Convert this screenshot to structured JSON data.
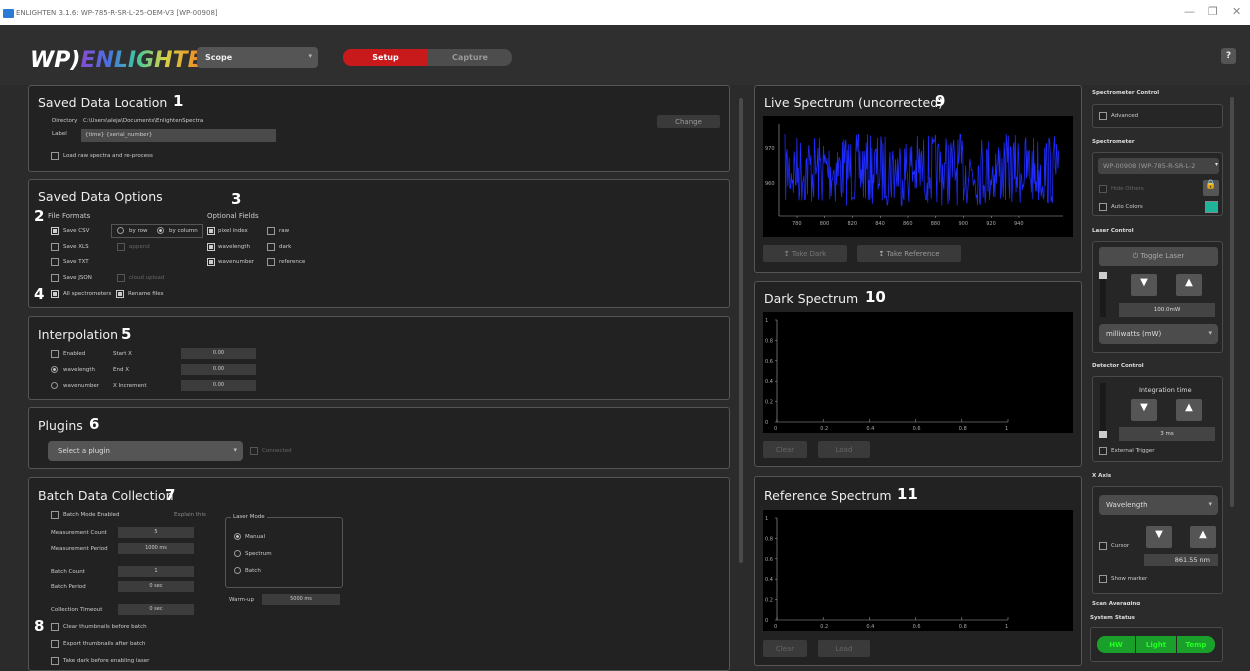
{
  "window": {
    "title": "ENLIGHTEN 3.1.6: WP-785-R-SR-L-25-OEM-V3 [WP-00908]"
  },
  "header": {
    "logo_wp": "WP",
    "logo_name": "ENLIGHTEN",
    "mode_select": "Scope",
    "tabs": [
      "Setup",
      "Capture"
    ],
    "active_tab": "Setup",
    "help_label": "?"
  },
  "saved_location": {
    "title": "Saved Data Location",
    "number": "1",
    "directory_label": "Directory",
    "directory_value": "C:\\Users\\aleja\\Documents\\EnlightenSpectra",
    "label_label": "Label",
    "label_value": "{time} {serial_number}",
    "change_button": "Change",
    "load_raw": "Load raw spectra and re-process",
    "load_raw_checked": false
  },
  "saved_options": {
    "title": "Saved Data Options",
    "number_main": "3",
    "number_formats": "2",
    "number_all": "4",
    "file_formats_label": "File Formats",
    "optional_fields_label": "Optional Fields",
    "formats": [
      {
        "label": "Save CSV",
        "checked": true
      },
      {
        "label": "Save XLS",
        "checked": false
      },
      {
        "label": "Save TXT",
        "checked": false
      },
      {
        "label": "Save JSON",
        "checked": false
      }
    ],
    "by_row": "by row",
    "by_column": "by column",
    "append": "append",
    "cloud_upload": "cloud upload",
    "fields_left": [
      {
        "label": "pixel index",
        "checked": true
      },
      {
        "label": "wavelength",
        "checked": true
      },
      {
        "label": "wavenumber",
        "checked": true
      }
    ],
    "fields_right": [
      {
        "label": "raw",
        "checked": false
      },
      {
        "label": "dark",
        "checked": false
      },
      {
        "label": "reference",
        "checked": false
      }
    ],
    "all_spectrometers": "All spectrometers",
    "rename_files": "Rename files"
  },
  "interpolation": {
    "title": "Interpolation",
    "number": "5",
    "enabled": "Enabled",
    "wavelength": "wavelength",
    "wavenumber": "wavenumber",
    "start_x": "Start X",
    "end_x": "End X",
    "x_increment": "X Increment",
    "start_val": "0.00",
    "end_val": "0.00",
    "inc_val": "0.00"
  },
  "plugins": {
    "title": "Plugins",
    "number": "6",
    "select": "Select a plugin",
    "connected": "Connected"
  },
  "batch": {
    "title": "Batch Data Collection",
    "number": "7",
    "number_thumb": "8",
    "mode_enabled": "Batch Mode Enabled",
    "explain": "Explain this",
    "measurement_count": "Measurement Count",
    "measurement_count_val": "5",
    "measurement_period": "Measurement Period",
    "measurement_period_val": "1000 ms",
    "batch_count": "Batch Count",
    "batch_count_val": "1",
    "batch_period": "Batch Period",
    "batch_period_val": "0 sec",
    "collection_timeout": "Collection Timeout",
    "collection_timeout_val": "0 sec",
    "laser_mode": "Laser Mode",
    "manual": "Manual",
    "spectrum": "Spectrum",
    "batch_opt": "Batch",
    "warmup": "Warm-up",
    "warmup_val": "5000 ms",
    "clear_thumbs": "Clear thumbnails before batch",
    "export_thumbs": "Export thumbnails after batch",
    "take_dark": "Take dark before enabling laser"
  },
  "live": {
    "title": "Live Spectrum (uncorrected)",
    "number": "9",
    "y_ticks": [
      "970",
      "960"
    ],
    "x_ticks": [
      "780",
      "800",
      "820",
      "840",
      "860",
      "880",
      "900",
      "920",
      "940"
    ],
    "take_dark": "Take Dark",
    "take_reference": "Take Reference",
    "line_color": "#1f2bff"
  },
  "dark": {
    "title": "Dark Spectrum",
    "number": "10",
    "y_ticks": [
      "1",
      "0.8",
      "0.6",
      "0.4",
      "0.2",
      "0"
    ],
    "x_ticks": [
      "0",
      "0.2",
      "0.4",
      "0.6",
      "0.8",
      "1"
    ],
    "clear": "Clear",
    "load": "Load"
  },
  "reference": {
    "title": "Reference Spectrum",
    "number": "11",
    "y_ticks": [
      "1",
      "0.8",
      "0.6",
      "0.4",
      "0.2",
      "0"
    ],
    "x_ticks": [
      "0",
      "0.2",
      "0.4",
      "0.6",
      "0.8",
      "1"
    ],
    "clear": "Clear",
    "load": "Load"
  },
  "right": {
    "spec_control": "Spectrometer Control",
    "advanced": "Advanced",
    "spectrometer": "Spectrometer",
    "spectrometer_value": "WP-00908 (WP-785-R-SR-L-2",
    "hide_others": "Hide Others",
    "auto_colors": "Auto Colors",
    "auto_color_swatch": "#1fb39a",
    "laser_control": "Laser Control",
    "toggle_laser": "Toggle Laser",
    "laser_power": "100.0mW",
    "laser_units": "milliwatts (mW)",
    "detector_control": "Detector Control",
    "integration_time": "Integration time",
    "integration_value": "3 ms",
    "external_trigger": "External Trigger",
    "x_axis": "X Axis",
    "x_axis_value": "Wavelength",
    "cursor": "Cursor",
    "cursor_value": "861.55 nm",
    "show_marker": "Show marker",
    "scan_averaging": "Scan Averaging",
    "system_status": "System Status",
    "status": [
      "HW",
      "Light",
      "Temp"
    ]
  }
}
